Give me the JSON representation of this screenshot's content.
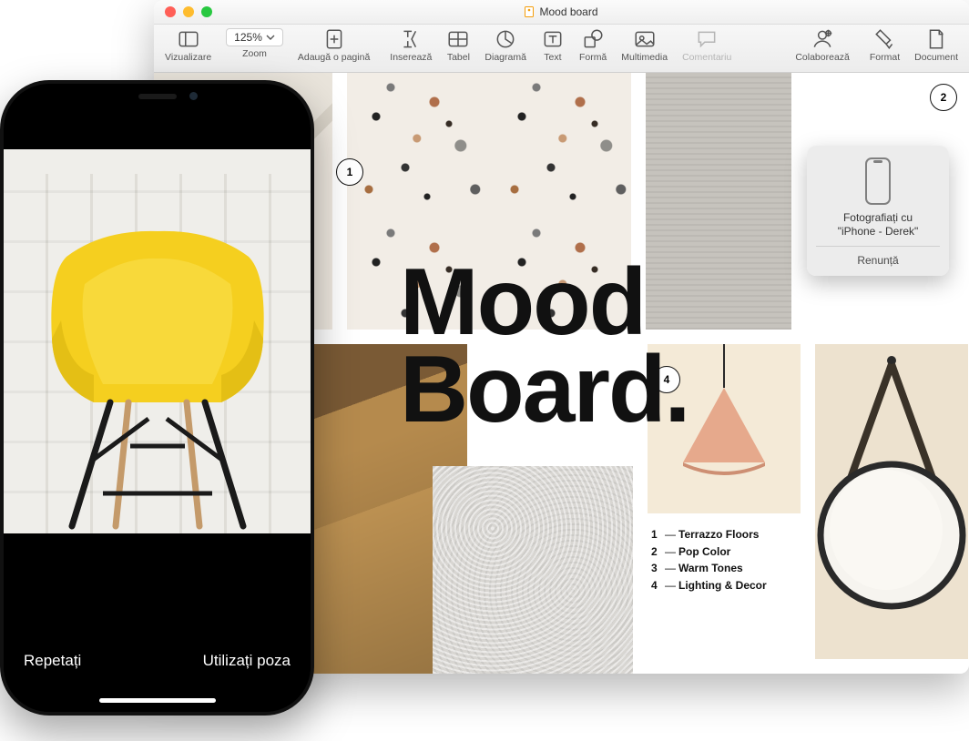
{
  "window": {
    "title": "Mood board"
  },
  "toolbar": {
    "view": "Vizualizare",
    "zoom_label": "Zoom",
    "zoom_value": "125%",
    "addpage": "Adaugă o pagină",
    "insert": "Inserează",
    "table": "Tabel",
    "chart": "Diagramă",
    "text": "Text",
    "shape": "Formă",
    "media": "Multimedia",
    "comment": "Comentariu",
    "collab": "Colaborează",
    "format": "Format",
    "document": "Document"
  },
  "document": {
    "title_line1": "Mood",
    "title_line2": "Board",
    "callouts": {
      "c1": "1",
      "c2": "2",
      "c4": "4"
    },
    "legend": [
      {
        "n": "1",
        "label": "Terrazzo Floors"
      },
      {
        "n": "2",
        "label": "Pop Color"
      },
      {
        "n": "3",
        "label": "Warm Tones"
      },
      {
        "n": "4",
        "label": "Lighting & Decor"
      }
    ]
  },
  "popover": {
    "line1": "Fotografiați cu",
    "line2": "\"iPhone - Derek\"",
    "cancel": "Renunță"
  },
  "phone": {
    "retake": "Repetați",
    "use": "Utilizați poza"
  }
}
